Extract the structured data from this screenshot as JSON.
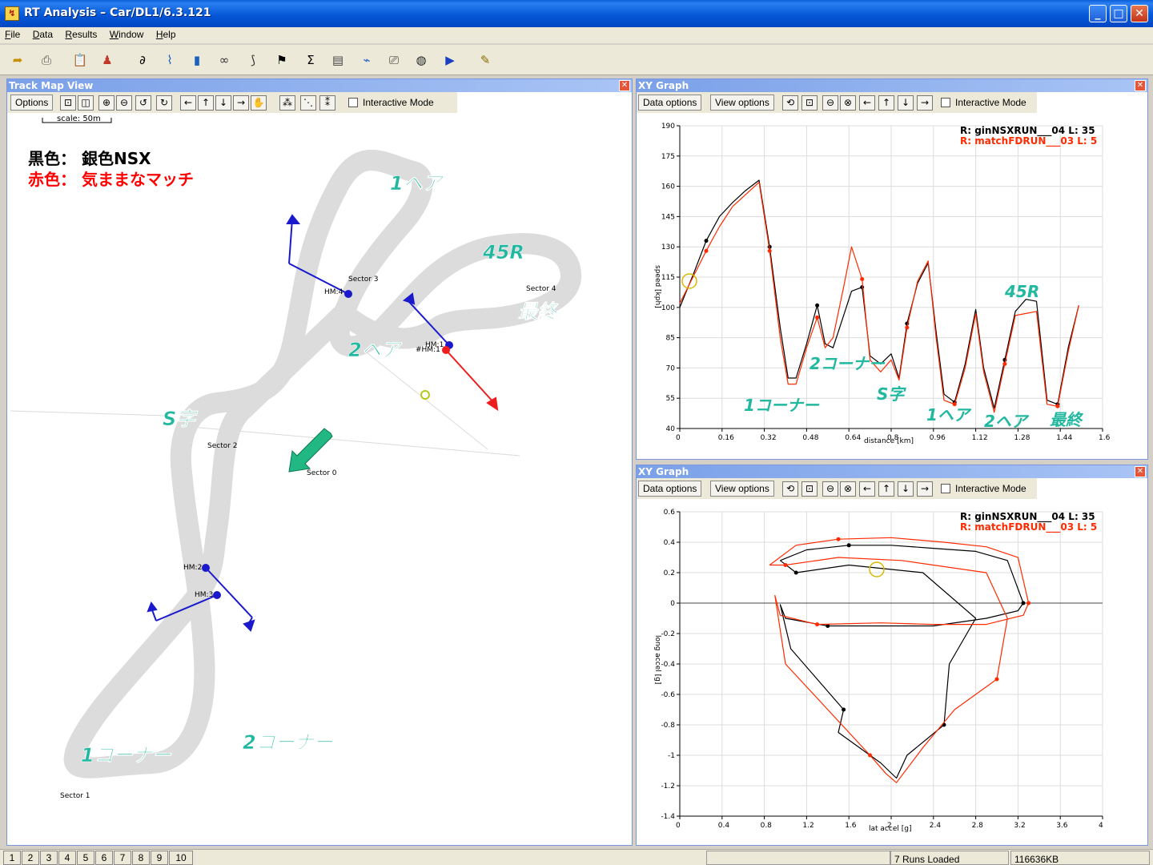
{
  "window": {
    "title": "RT Analysis – Car/DL1/6.3.121"
  },
  "menu": [
    "File",
    "Data",
    "Results",
    "Window",
    "Help"
  ],
  "track_panel": {
    "title": "Track Map View",
    "options_label": "Options",
    "interactive_label": "Interactive Mode",
    "scale_label": "scale: 50m",
    "legend_black": "黒色：  銀色NSX",
    "legend_red": "赤色：  気ままなマッチ",
    "sector_labels": {
      "s0": "Sector 0",
      "s1": "Sector 1",
      "s2": "Sector 2",
      "s3": "Sector 3",
      "s4": "Sector 4"
    },
    "marker_labels": {
      "hm1": "#HM:1",
      "hm1b": "HM:1",
      "hm2": "HM:2",
      "hm3": "HM:3",
      "hm4": "HM:4"
    },
    "annotations": {
      "hair1": "1ヘア",
      "r45": "45R",
      "final": "最終",
      "hair2": "2ヘア",
      "s_curve": "S字",
      "corner2": "2コーナー",
      "corner1": "1コーナー"
    }
  },
  "graph_speed": {
    "title": "XY Graph",
    "data_options_label": "Data options",
    "view_options_label": "View options",
    "interactive_label": "Interactive Mode",
    "legend": [
      "R: ginNSXRUN___04  L: 35",
      "R: matchFDRUN___03  L: 5"
    ],
    "annotations": {
      "c1": "1コーナー",
      "c2": "2コーナー",
      "s": "S字",
      "h1": "1ヘア",
      "h2": "2ヘア",
      "r45": "45R",
      "fin": "最終"
    },
    "chart_data": {
      "type": "line",
      "xlabel": "distance [km]",
      "ylabel": "speed [kph]",
      "xlim": [
        0,
        1.6
      ],
      "ylim": [
        40,
        190
      ],
      "xticks": [
        "0",
        "0.16",
        "0.32",
        "0.48",
        "0.64",
        "0.8",
        "0.96",
        "1.12",
        "1.28",
        "1.44",
        "1.6"
      ],
      "yticks": [
        "190",
        "175",
        "160",
        "145",
        "130",
        "115",
        "100",
        "85",
        "70",
        "55",
        "40"
      ],
      "grid": true,
      "legend_position": "top-right",
      "series": [
        {
          "name": "R: ginNSXRUN___04  L: 35",
          "color": "#000000",
          "x": [
            0,
            0.05,
            0.1,
            0.15,
            0.2,
            0.25,
            0.3,
            0.34,
            0.38,
            0.41,
            0.44,
            0.48,
            0.52,
            0.55,
            0.58,
            0.62,
            0.65,
            0.69,
            0.72,
            0.76,
            0.8,
            0.83,
            0.86,
            0.9,
            0.94,
            0.97,
            1.0,
            1.04,
            1.08,
            1.12,
            1.15,
            1.19,
            1.23,
            1.27,
            1.31,
            1.35,
            1.39,
            1.43,
            1.47,
            1.51
          ],
          "y": [
            100,
            116,
            133,
            145,
            152,
            158,
            163,
            130,
            90,
            65,
            65,
            82,
            101,
            82,
            80,
            96,
            108,
            110,
            76,
            72,
            77,
            65,
            92,
            112,
            122,
            88,
            57,
            53,
            72,
            99,
            70,
            50,
            74,
            98,
            104,
            103,
            54,
            52,
            80,
            101
          ]
        },
        {
          "name": "R: matchFDRUN___03  L: 5",
          "color": "#ff2a00",
          "x": [
            0,
            0.05,
            0.1,
            0.15,
            0.2,
            0.25,
            0.3,
            0.34,
            0.38,
            0.41,
            0.44,
            0.48,
            0.52,
            0.55,
            0.58,
            0.62,
            0.65,
            0.69,
            0.72,
            0.76,
            0.8,
            0.83,
            0.86,
            0.9,
            0.94,
            0.97,
            1.0,
            1.04,
            1.08,
            1.12,
            1.15,
            1.19,
            1.23,
            1.27,
            1.31,
            1.35,
            1.39,
            1.43,
            1.47,
            1.51
          ],
          "y": [
            102,
            115,
            128,
            140,
            150,
            156,
            162,
            128,
            85,
            62,
            62,
            80,
            95,
            80,
            85,
            110,
            130,
            114,
            74,
            68,
            74,
            64,
            90,
            113,
            123,
            85,
            54,
            52,
            70,
            97,
            68,
            48,
            72,
            96,
            97,
            98,
            52,
            51,
            78,
            101
          ]
        }
      ]
    }
  },
  "graph_gg": {
    "title": "XY Graph",
    "data_options_label": "Data options",
    "view_options_label": "View options",
    "interactive_label": "Interactive Mode",
    "legend": [
      "R: ginNSXRUN___04  L: 35",
      "R: matchFDRUN___03  L: 5"
    ],
    "chart_data": {
      "type": "scatter",
      "xlabel": "lat accel [g]",
      "ylabel": "long accel [g]",
      "xlim": [
        0,
        4
      ],
      "ylim": [
        -1.4,
        0.6
      ],
      "xticks": [
        "0",
        "0.4",
        "0.8",
        "1.2",
        "1.6",
        "2",
        "2.4",
        "2.8",
        "3.2",
        "3.6",
        "4"
      ],
      "yticks": [
        "0.6",
        "0.4",
        "0.2",
        "0",
        "-0.2",
        "-0.4",
        "-0.6",
        "-0.8",
        "-1",
        "-1.2",
        "-1.4"
      ],
      "grid": true,
      "legend_position": "top-right",
      "series": [
        {
          "name": "R: ginNSXRUN___04  L: 35",
          "color": "#000000",
          "x": [
            0.95,
            1.2,
            1.6,
            2.0,
            2.4,
            2.8,
            3.1,
            3.25,
            3.2,
            2.9,
            2.4,
            1.9,
            1.4,
            1.0,
            0.95,
            1.05,
            1.3,
            1.55,
            1.5,
            1.9,
            2.05,
            2.15,
            2.5,
            2.55,
            2.8,
            2.3,
            1.6,
            1.1
          ],
          "y": [
            0.28,
            0.35,
            0.38,
            0.38,
            0.36,
            0.34,
            0.28,
            0.0,
            -0.05,
            -0.1,
            -0.15,
            -0.15,
            -0.15,
            -0.1,
            -0.01,
            -0.3,
            -0.5,
            -0.7,
            -0.85,
            -1.05,
            -1.15,
            -1.0,
            -0.8,
            -0.4,
            -0.1,
            0.2,
            0.25,
            0.2
          ]
        },
        {
          "name": "R: matchFDRUN___03  L: 5",
          "color": "#ff2a00",
          "x": [
            0.85,
            1.1,
            1.5,
            2.0,
            2.5,
            2.9,
            3.2,
            3.3,
            3.25,
            2.9,
            2.4,
            1.9,
            1.3,
            0.95,
            0.9,
            1.0,
            1.4,
            1.8,
            1.95,
            2.05,
            2.3,
            2.6,
            3.0,
            3.1,
            2.9,
            2.1,
            1.5,
            1.0
          ],
          "y": [
            0.25,
            0.38,
            0.42,
            0.43,
            0.4,
            0.37,
            0.3,
            0.0,
            -0.08,
            -0.14,
            -0.14,
            -0.13,
            -0.14,
            -0.08,
            0.05,
            -0.4,
            -0.7,
            -1.0,
            -1.12,
            -1.18,
            -0.95,
            -0.7,
            -0.5,
            -0.1,
            0.2,
            0.28,
            0.3,
            0.25
          ]
        }
      ]
    }
  },
  "status": {
    "tabs": [
      "1",
      "2",
      "3",
      "4",
      "5",
      "6",
      "7",
      "8",
      "9",
      "10"
    ],
    "runs_loaded": "7 Runs Loaded",
    "memory": "116636KB"
  }
}
